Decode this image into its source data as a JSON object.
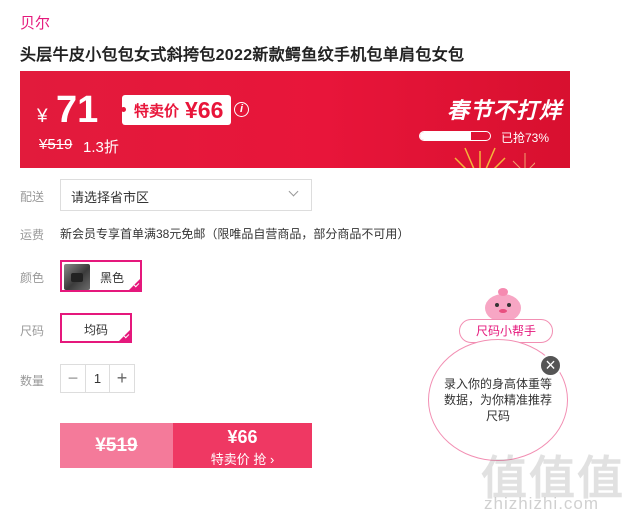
{
  "brand": "贝尔",
  "product_title": "头层牛皮小包包女式斜挎包2022新款鳄鱼纹手机包单肩包女包",
  "banner": {
    "currency": "¥",
    "price": "71",
    "tag_label": "特卖价",
    "tag_price": "¥66",
    "info_icon": "info-icon",
    "original_price": "¥519",
    "discount": "1.3折",
    "festival_text": "春节不打烊",
    "sold_text": "已抢73%",
    "sold_percent": 73
  },
  "rows": {
    "delivery_label": "配送",
    "delivery_select": "请选择省市区",
    "shipping_label": "运费",
    "shipping_text": "新会员专享首单满38元免邮（限唯品自营商品，部分商品不可用）",
    "color_label": "颜色",
    "color_option": "黑色",
    "size_label": "尺码",
    "size_option": "均码",
    "qty_label": "数量",
    "qty_minus": "−",
    "qty_value": "1",
    "qty_plus": "+"
  },
  "buy": {
    "original_price": "¥519",
    "sale_price": "¥66",
    "sale_text": "特卖价 抢 ›"
  },
  "size_helper": {
    "pill": "尺码小帮手",
    "bubble_text": "录入你的身高体重等数据，为你精准推荐尺码",
    "close": "×"
  },
  "watermark": {
    "logo": "值",
    "site": "zhizhizhi.com"
  },
  "colors": {
    "accent": "#e5187c",
    "banner_red": "#e8153a",
    "buy_pink": "#f47a9a",
    "buy_red": "#ef3863"
  }
}
